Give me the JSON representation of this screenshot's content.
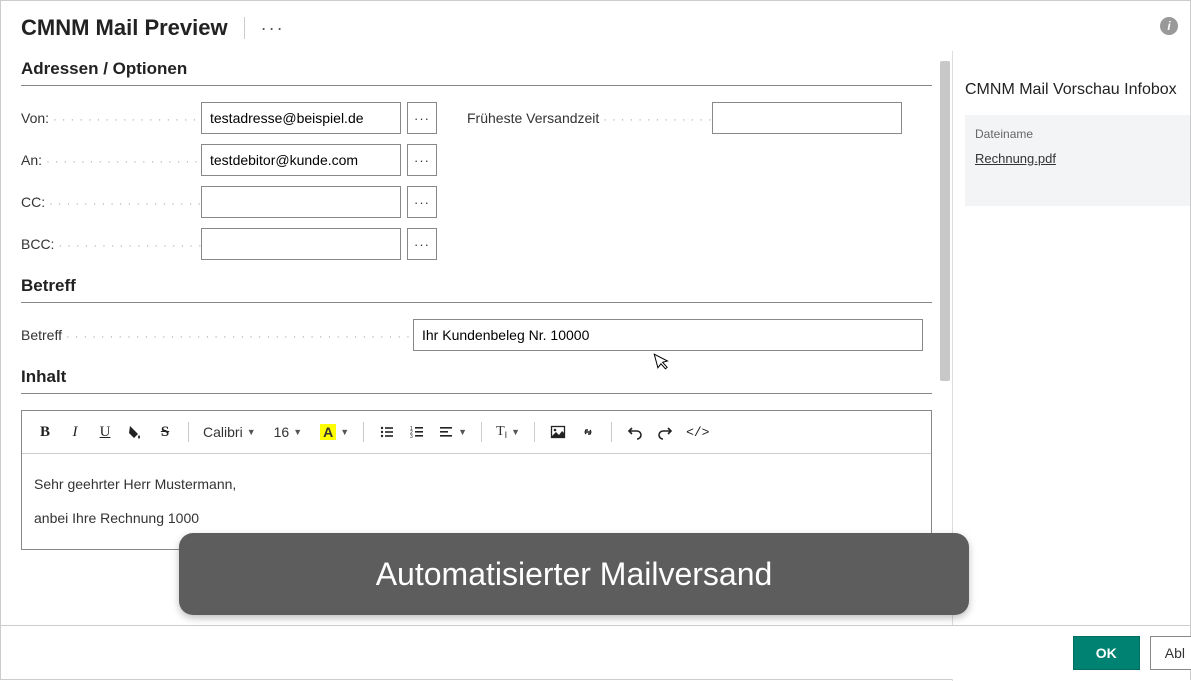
{
  "header": {
    "title": "CMNM Mail Preview",
    "more": "···",
    "info": "i"
  },
  "sections": {
    "addresses": "Adressen / Optionen",
    "subject": "Betreff",
    "content": "Inhalt"
  },
  "fields": {
    "from_label": "Von:",
    "from_value": "testadresse@beispiel.de",
    "to_label": "An:",
    "to_value": "testdebitor@kunde.com",
    "cc_label": "CC:",
    "cc_value": "",
    "bcc_label": "BCC:",
    "bcc_value": "",
    "sendtime_label": "Früheste Versandzeit",
    "sendtime_value": "",
    "subject_label": "Betreff",
    "subject_value": "Ihr Kundenbeleg Nr. 10000",
    "lookup": "···"
  },
  "toolbar": {
    "font": "Calibri",
    "size": "16",
    "color_letter": "A",
    "text_label": "T",
    "code_label": "</>"
  },
  "editor": {
    "line1": "Sehr geehrter Herr Mustermann,",
    "line2": "anbei Ihre Rechnung 1000"
  },
  "sidebar": {
    "title": "CMNM Mail Vorschau Infobox",
    "filename_label": "Dateiname",
    "filename_value": "Rechnung.pdf"
  },
  "footer": {
    "ok": "OK",
    "cancel": "Abl"
  },
  "overlay": "Automatisierter Mailversand"
}
